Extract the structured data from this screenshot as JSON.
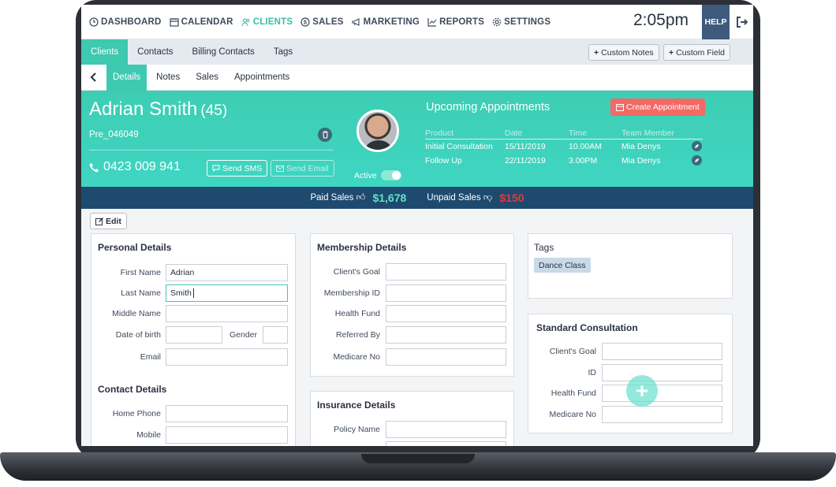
{
  "topnav": {
    "items": [
      {
        "label": "DASHBOARD",
        "icon": "clock-icon"
      },
      {
        "label": "CALENDAR",
        "icon": "calendar-icon"
      },
      {
        "label": "CLIENTS",
        "icon": "users-icon",
        "active": true
      },
      {
        "label": "SALES",
        "icon": "dollar-icon"
      },
      {
        "label": "MARKETING",
        "icon": "megaphone-icon"
      },
      {
        "label": "REPORTS",
        "icon": "chart-icon"
      },
      {
        "label": "SETTINGS",
        "icon": "gear-icon"
      }
    ],
    "clock": "2:05pm",
    "help": "HELP"
  },
  "tabs": {
    "primary": [
      "Clients",
      "Contacts",
      "Billing Contacts",
      "Tags"
    ],
    "custom_notes": "Custom Notes",
    "custom_field": "Custom Field",
    "secondary": [
      "Details",
      "Notes",
      "Sales",
      "Appointments"
    ]
  },
  "client": {
    "name": "Adrian Smith",
    "age": "(45)",
    "id": "Pre_046049",
    "phone": "0423 009 941",
    "send_sms": "Send SMS",
    "send_email": "Send Email",
    "active_label": "Active",
    "active": true
  },
  "appointments": {
    "title": "Upcoming Appointments",
    "create_label": "Create Appointment",
    "headers": [
      "Product",
      "Date",
      "Time",
      "Team Member"
    ],
    "rows": [
      [
        "Initial Consultation",
        "15/11/2019",
        "10.00AM",
        "Mia Denys"
      ],
      [
        "Follow Up",
        "22/11/2019",
        "3.00PM",
        "Mia Denys"
      ]
    ]
  },
  "sales": {
    "paid_label": "Paid Sales",
    "paid_value": "$1,678",
    "unpaid_label": "Unpaid Sales",
    "unpaid_value": "$150"
  },
  "edit_label": "Edit",
  "personal": {
    "title": "Personal Details",
    "first_name_label": "First Name",
    "first_name": "Adrian",
    "last_name_label": "Last Name",
    "last_name": "Smith",
    "middle_name_label": "Middle Name",
    "middle_name": "",
    "dob_label": "Date of birth",
    "dob": "",
    "gender_label": "Gender",
    "gender": "",
    "email_label": "Email",
    "email": ""
  },
  "contact": {
    "title": "Contact Details",
    "home_phone_label": "Home Phone",
    "mobile_label": "Mobile"
  },
  "membership": {
    "title": "Membership Details",
    "labels": [
      "Client's Goal",
      "Membership ID",
      "Health Fund",
      "Referred By",
      "Medicare No"
    ]
  },
  "insurance": {
    "title": "Insurance Details",
    "policy_label": "Policy Name"
  },
  "tags": {
    "title": "Tags",
    "items": [
      "Dance Class"
    ]
  },
  "standard": {
    "title": "Standard Consultation",
    "labels": [
      "Client's Goal",
      "ID",
      "Health Fund",
      "Medicare No"
    ]
  },
  "colors": {
    "accent": "#3ec9b1",
    "navy": "#1e4a70",
    "danger": "#f16a66"
  }
}
